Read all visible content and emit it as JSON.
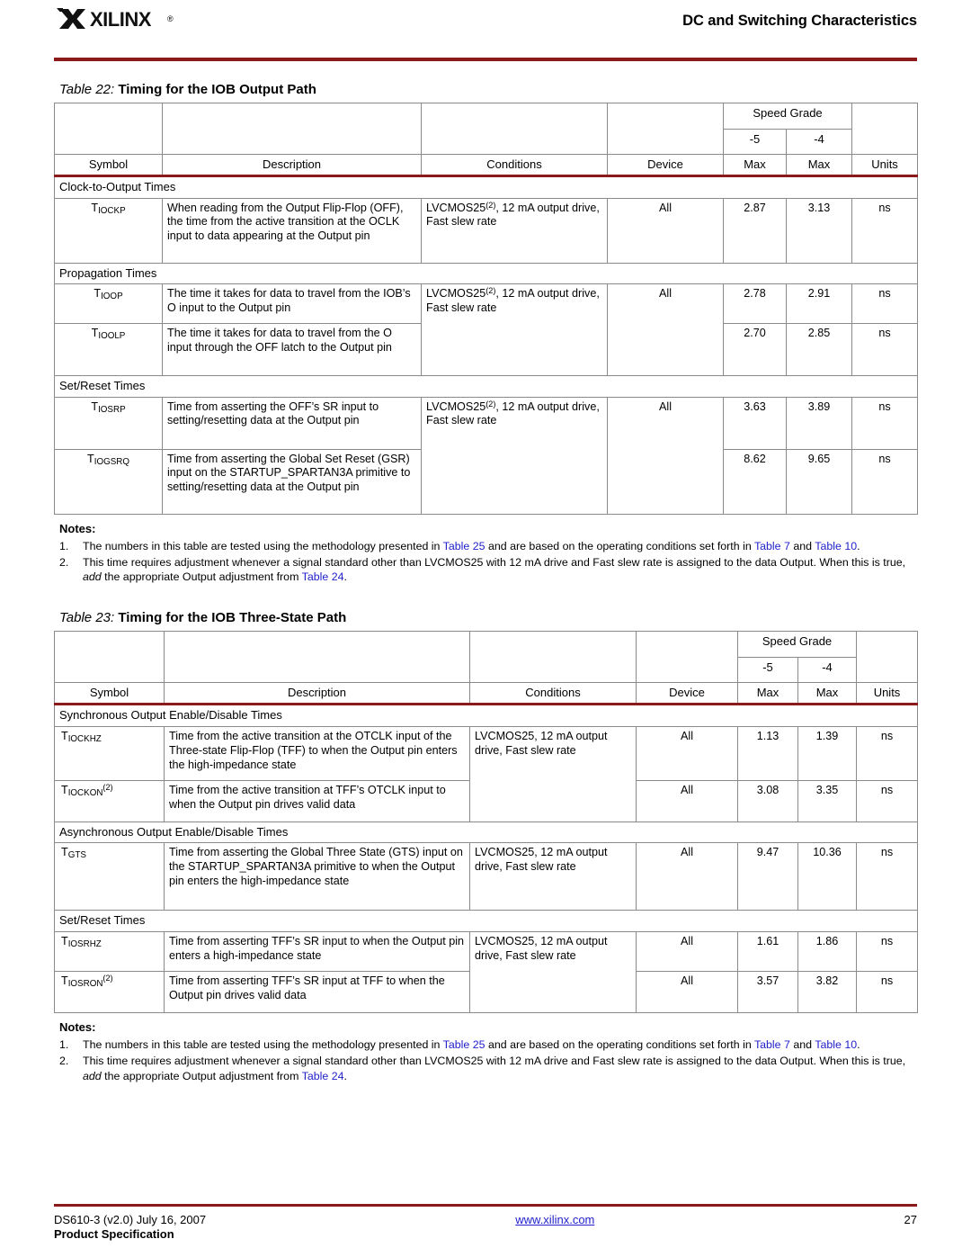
{
  "header": {
    "brand": "XILINX",
    "registered_mark": "®",
    "title": "DC and Switching Characteristics"
  },
  "table22": {
    "caption_num": "Table  22:",
    "caption_text": "Timing for the IOB Output Path",
    "columns": {
      "symbol": "Symbol",
      "description": "Description",
      "conditions": "Conditions",
      "device": "Device",
      "speed_grade": "Speed Grade",
      "grade_5": "-5",
      "grade_4": "-4",
      "max_5": "Max",
      "max_4": "Max",
      "units": "Units"
    },
    "sections": [
      {
        "label": "Clock-to-Output Times",
        "rows": [
          {
            "symbol_t": "T",
            "symbol_sub": "IOCKP",
            "symbol_sup": "",
            "description": "When reading from the Output Flip-Flop (OFF), the time from the active transition at the OCLK input to data appearing at the Output pin",
            "conditions_pre": "LVCMOS25",
            "conditions_sup": "(2)",
            "conditions_post": ", 12 mA output drive, Fast slew rate",
            "device": "All",
            "max_5": "2.87",
            "max_4": "3.13",
            "units": "ns"
          }
        ]
      },
      {
        "label": "Propagation Times",
        "rows": [
          {
            "symbol_t": "T",
            "symbol_sub": "IOOP",
            "symbol_sup": "",
            "description": "The time it takes for data to travel from the IOB’s O input to the Output pin",
            "conditions_pre": "LVCMOS25",
            "conditions_sup": "(2)",
            "conditions_post": ", 12 mA output drive, Fast slew rate",
            "device": "All",
            "max_5": "2.78",
            "max_4": "2.91",
            "units": "ns"
          },
          {
            "symbol_t": "T",
            "symbol_sub": "IOOLP",
            "symbol_sup": "",
            "description": "The time it takes for data to travel from the O input through the OFF latch to the Output pin",
            "conditions_pre": "",
            "conditions_sup": "",
            "conditions_post": "",
            "device": "",
            "max_5": "2.70",
            "max_4": "2.85",
            "units": "ns"
          }
        ]
      },
      {
        "label": "Set/Reset Times",
        "rows": [
          {
            "symbol_t": "T",
            "symbol_sub": "IOSRP",
            "symbol_sup": "",
            "description": "Time from asserting the OFF’s SR input to setting/resetting data at the Output pin",
            "conditions_pre": "LVCMOS25",
            "conditions_sup": "(2)",
            "conditions_post": ", 12 mA output drive, Fast slew rate",
            "device": "All",
            "max_5": "3.63",
            "max_4": "3.89",
            "units": "ns"
          },
          {
            "symbol_t": "T",
            "symbol_sub": "IOGSRQ",
            "symbol_sup": "",
            "description": "Time from asserting the Global Set Reset (GSR) input on the STARTUP_SPARTAN3A primitive to setting/resetting data at the Output pin",
            "conditions_pre": "",
            "conditions_sup": "",
            "conditions_post": "",
            "device": "",
            "max_5": "8.62",
            "max_4": "9.65",
            "units": "ns"
          }
        ]
      }
    ],
    "notes_title": "Notes:",
    "notes": [
      {
        "num": "1.",
        "parts": [
          {
            "t": "The numbers in this table are tested using the methodology presented in ",
            "k": "txt"
          },
          {
            "t": "Table 25",
            "k": "lnk"
          },
          {
            "t": " and are based on the operating conditions set forth in ",
            "k": "txt"
          },
          {
            "t": "Table 7",
            "k": "lnk"
          },
          {
            "t": " and ",
            "k": "txt"
          },
          {
            "t": "Table 10",
            "k": "lnk"
          },
          {
            "t": ".",
            "k": "txt"
          }
        ]
      },
      {
        "num": "2.",
        "parts": [
          {
            "t": "This time requires adjustment whenever a signal standard other than LVCMOS25 with 12 mA drive and Fast slew rate is assigned to the data Output. When this is true, ",
            "k": "txt"
          },
          {
            "t": "add",
            "k": "ital"
          },
          {
            "t": " the appropriate Output adjustment from ",
            "k": "txt"
          },
          {
            "t": "Table 24",
            "k": "lnk"
          },
          {
            "t": ".",
            "k": "txt"
          }
        ]
      }
    ]
  },
  "table23": {
    "caption_num": "Table  23:",
    "caption_text": "Timing for the IOB Three-State Path",
    "columns": {
      "symbol": "Symbol",
      "description": "Description",
      "conditions": "Conditions",
      "device": "Device",
      "speed_grade": "Speed Grade",
      "grade_5": "-5",
      "grade_4": "-4",
      "max_5": "Max",
      "max_4": "Max",
      "units": "Units"
    },
    "sections": [
      {
        "label": "Synchronous Output Enable/Disable Times",
        "rows": [
          {
            "symbol_t": "T",
            "symbol_sub": "IOCKHZ",
            "symbol_sup": "",
            "symbol_align": "center",
            "description": "Time from the active transition at the OTCLK input of the Three-state Flip-Flop (TFF) to when the Output pin enters the high-impedance state",
            "conditions": "LVCMOS25, 12 mA output drive, Fast slew rate",
            "device": "All",
            "max_5": "1.13",
            "max_4": "1.39",
            "units": "ns"
          },
          {
            "symbol_t": "T",
            "symbol_sub": "IOCKON",
            "symbol_sup": "(2)",
            "symbol_align": "left",
            "description": "Time from the active transition at TFF’s OTCLK input to when the Output pin drives valid data",
            "conditions": "",
            "device": "All",
            "max_5": "3.08",
            "max_4": "3.35",
            "units": "ns"
          }
        ]
      },
      {
        "label": "Asynchronous Output Enable/Disable Times",
        "rows": [
          {
            "symbol_t": "T",
            "symbol_sub": "GTS",
            "symbol_sup": "",
            "symbol_align": "left",
            "description": "Time from asserting the Global Three State (GTS) input on the STARTUP_SPARTAN3A primitive to when the Output pin enters the high-impedance state",
            "conditions": "LVCMOS25, 12 mA output drive, Fast slew rate",
            "device": "All",
            "max_5": "9.47",
            "max_4": "10.36",
            "units": "ns"
          }
        ]
      },
      {
        "label": "Set/Reset Times",
        "rows": [
          {
            "symbol_t": "T",
            "symbol_sub": "IOSRHZ",
            "symbol_sup": "",
            "symbol_align": "left",
            "description": "Time from asserting TFF’s SR input to when the Output pin enters a high-impedance state",
            "conditions": "LVCMOS25, 12 mA output drive, Fast slew rate",
            "device": "All",
            "max_5": "1.61",
            "max_4": "1.86",
            "units": "ns"
          },
          {
            "symbol_t": "T",
            "symbol_sub": "IOSRON",
            "symbol_sup": "(2)",
            "symbol_align": "left",
            "description": "Time from asserting TFF’s SR input at TFF to when the Output pin drives valid data",
            "conditions": "",
            "device": "All",
            "max_5": "3.57",
            "max_4": "3.82",
            "units": "ns"
          }
        ]
      }
    ],
    "notes_title": "Notes:",
    "notes": [
      {
        "num": "1.",
        "parts": [
          {
            "t": "The numbers in this table are tested using the methodology presented in ",
            "k": "txt"
          },
          {
            "t": "Table 25",
            "k": "lnk"
          },
          {
            "t": " and are based on the operating conditions set forth in ",
            "k": "txt"
          },
          {
            "t": "Table 7",
            "k": "lnk"
          },
          {
            "t": " and ",
            "k": "txt"
          },
          {
            "t": "Table 10",
            "k": "lnk"
          },
          {
            "t": ".",
            "k": "txt"
          }
        ]
      },
      {
        "num": "2.",
        "parts": [
          {
            "t": "This time requires adjustment whenever a signal standard other than LVCMOS25 with 12 mA drive and Fast slew rate is assigned to the data Output. When this is true, ",
            "k": "txt"
          },
          {
            "t": "add",
            "k": "ital"
          },
          {
            "t": " the appropriate Output adjustment from ",
            "k": "txt"
          },
          {
            "t": "Table 24",
            "k": "lnk"
          },
          {
            "t": ".",
            "k": "txt"
          }
        ]
      }
    ]
  },
  "footer": {
    "doc_id": "DS610-3 (v2.0) July 16, 2007",
    "url": "www.xilinx.com",
    "page_number": "27",
    "subtitle": "Product Specification"
  },
  "colors": {
    "rule": "#8b1a1a",
    "link": "#2222cc",
    "border": "#8a8a8a"
  }
}
